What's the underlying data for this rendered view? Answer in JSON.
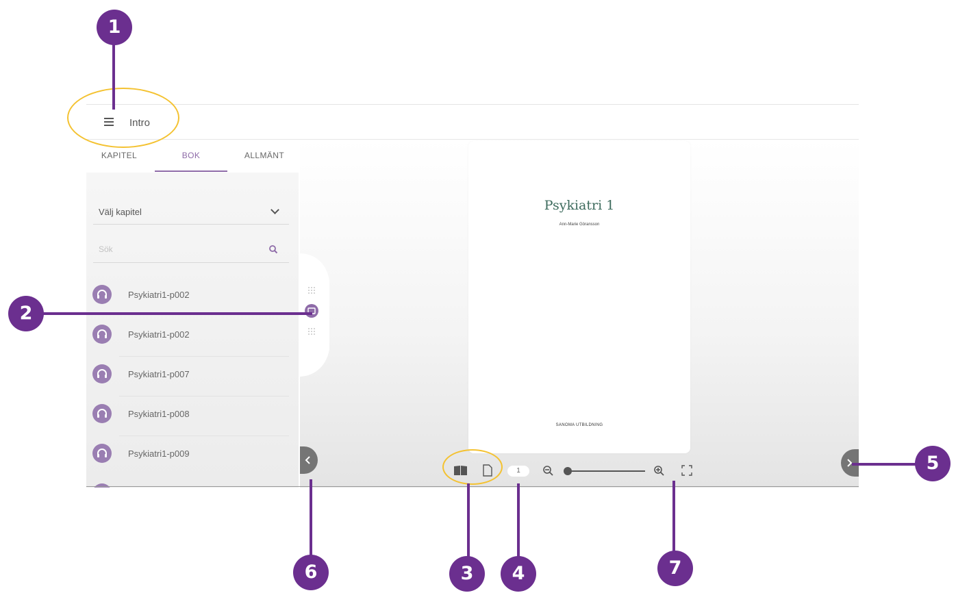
{
  "header": {
    "title": "Intro",
    "menu_icon": "hamburger-menu-icon"
  },
  "sidebar": {
    "tabs": [
      {
        "label": "KAPITEL"
      },
      {
        "label": "BOK"
      },
      {
        "label": "ALLMÄNT"
      }
    ],
    "active_tab": "BOK",
    "chapter_select": {
      "value": "Välj kapitel"
    },
    "search": {
      "placeholder": "Sök"
    },
    "items": [
      {
        "label": "Psykiatri1-p002"
      },
      {
        "label": "Psykiatri1-p002"
      },
      {
        "label": "Psykiatri1-p007"
      },
      {
        "label": "Psykiatri1-p008"
      },
      {
        "label": "Psykiatri1-p009"
      }
    ]
  },
  "book": {
    "title": "Psykiatri 1",
    "author": "Ann-Marie Göransson",
    "publisher": "SANOMA UTBILDNING"
  },
  "toolbar": {
    "page_number": "1",
    "zoom_level": 0
  },
  "annotations": [
    "1",
    "2",
    "3",
    "4",
    "5",
    "6",
    "7"
  ],
  "colors": {
    "accent": "#8e6ba8",
    "annotation": "#6b2f8f",
    "highlight": "#f4c231"
  }
}
